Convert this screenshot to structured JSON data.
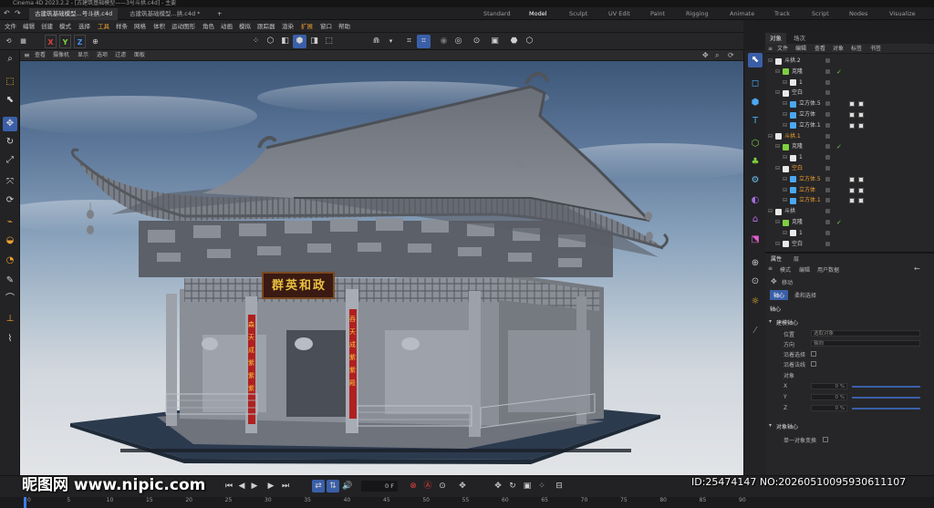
{
  "window": {
    "title": "Cinema 4D 2023.2.2 - [古建筑基础模型——3号斗拱.c4d] - 主要"
  },
  "doc_tabs": [
    "古建筑基础模型...号斗拱.c4d",
    "古建筑基础模型...拱.c4d *"
  ],
  "doc_tab_add": "+",
  "workspaces": [
    "Standard",
    "Model",
    "Sculpt",
    "UV Edit",
    "Paint",
    "Rigging",
    "Animate",
    "Track",
    "Script",
    "Nodes",
    "Visualize"
  ],
  "active_workspace": "Model",
  "main_menu": [
    "文件",
    "编辑",
    "创建",
    "模式",
    "选择",
    "工具",
    "样条",
    "网格",
    "体积",
    "运动图形",
    "角色",
    "动画",
    "模拟",
    "跟踪器",
    "渲染",
    "扩展",
    "窗口",
    "帮助"
  ],
  "highlight_menu": [
    "工具",
    "扩展"
  ],
  "axes": {
    "x": "X",
    "y": "Y",
    "z": "Z"
  },
  "colors": {
    "accent": "#3a5fa8",
    "x_axis": "#e04040",
    "y_axis": "#7ed040",
    "z_axis": "#4090f0",
    "check": "#6fcf3f",
    "orange": "#f0a030"
  },
  "viewport": {
    "menu": [
      "查看",
      "摄像机",
      "显示",
      "选项",
      "过滤",
      "面板"
    ],
    "plaque_text": "群英和政",
    "couplet_left": "森天成紫紫紫",
    "couplet_right": "吞天成紫紫殿"
  },
  "object_panel": {
    "tabs": [
      "对象",
      "场次"
    ],
    "menu": [
      "文件",
      "编辑",
      "查看",
      "对象",
      "标签",
      "书签"
    ],
    "items": [
      {
        "name": "斗拱.2",
        "color": "#d0d0d0",
        "level": 0,
        "check": false,
        "tags": false
      },
      {
        "name": "克隆",
        "color": "#d0d0d0",
        "level": 1,
        "check": true,
        "tags": false
      },
      {
        "name": "1",
        "color": "#d0d0d0",
        "level": 2,
        "check": false,
        "tags": false
      },
      {
        "name": "空白",
        "color": "#d0d0d0",
        "level": 1,
        "check": false,
        "tags": false
      },
      {
        "name": "立方体.5",
        "color": "#d0d0d0",
        "level": 2,
        "check": false,
        "tags": true
      },
      {
        "name": "立方体",
        "color": "#d0d0d0",
        "level": 2,
        "check": false,
        "tags": true
      },
      {
        "name": "立方体.1",
        "color": "#d0d0d0",
        "level": 2,
        "check": false,
        "tags": true
      },
      {
        "name": "斗拱.1",
        "color": "#f0a030",
        "level": 0,
        "check": false,
        "tags": false
      },
      {
        "name": "克隆",
        "color": "#d0d0d0",
        "level": 1,
        "check": true,
        "tags": false
      },
      {
        "name": "1",
        "color": "#d0d0d0",
        "level": 2,
        "check": false,
        "tags": false
      },
      {
        "name": "空白",
        "color": "#f0a030",
        "level": 1,
        "check": false,
        "tags": false
      },
      {
        "name": "立方体.5",
        "color": "#f0a030",
        "level": 2,
        "check": false,
        "tags": true
      },
      {
        "name": "立方体",
        "color": "#f0a030",
        "level": 2,
        "check": false,
        "tags": true
      },
      {
        "name": "立方体.1",
        "color": "#f0a030",
        "level": 2,
        "check": false,
        "tags": true
      },
      {
        "name": "斗拱",
        "color": "#d0d0d0",
        "level": 0,
        "check": false,
        "tags": false
      },
      {
        "name": "克隆",
        "color": "#d0d0d0",
        "level": 1,
        "check": true,
        "tags": false
      },
      {
        "name": "1",
        "color": "#d0d0d0",
        "level": 2,
        "check": false,
        "tags": false
      },
      {
        "name": "空白",
        "color": "#d0d0d0",
        "level": 1,
        "check": false,
        "tags": false
      }
    ]
  },
  "attr_panel": {
    "tabs": [
      "属性",
      "层"
    ],
    "menu": [
      "模式",
      "编辑",
      "用户数据"
    ],
    "tool_name": "移动",
    "subtabs": [
      "轴心",
      "柔和选择"
    ],
    "section": "轴心",
    "group1": "建模轴心",
    "position_label": "位置",
    "position_value": "选取对象",
    "orientation_label": "方向",
    "orientation_value": "轴向",
    "check1": "沿着选择",
    "check2": "沿着法线",
    "object_label": "对象",
    "x_label": "X",
    "x_value": "0 %",
    "y_label": "Y",
    "y_value": "0 %",
    "z_label": "Z",
    "z_value": "0 %",
    "group2": "对象轴心",
    "check3": "单一对象变换"
  },
  "timeline": {
    "frame": "0 F",
    "ruler": [
      "0",
      "5",
      "10",
      "15",
      "20",
      "25",
      "30",
      "35",
      "40",
      "45",
      "50",
      "55",
      "60",
      "65",
      "70",
      "75",
      "80",
      "85",
      "90"
    ]
  },
  "watermark": {
    "left": "昵图网 www.nipic.com",
    "right": "ID:25474147 NO:20260510095930611107"
  }
}
